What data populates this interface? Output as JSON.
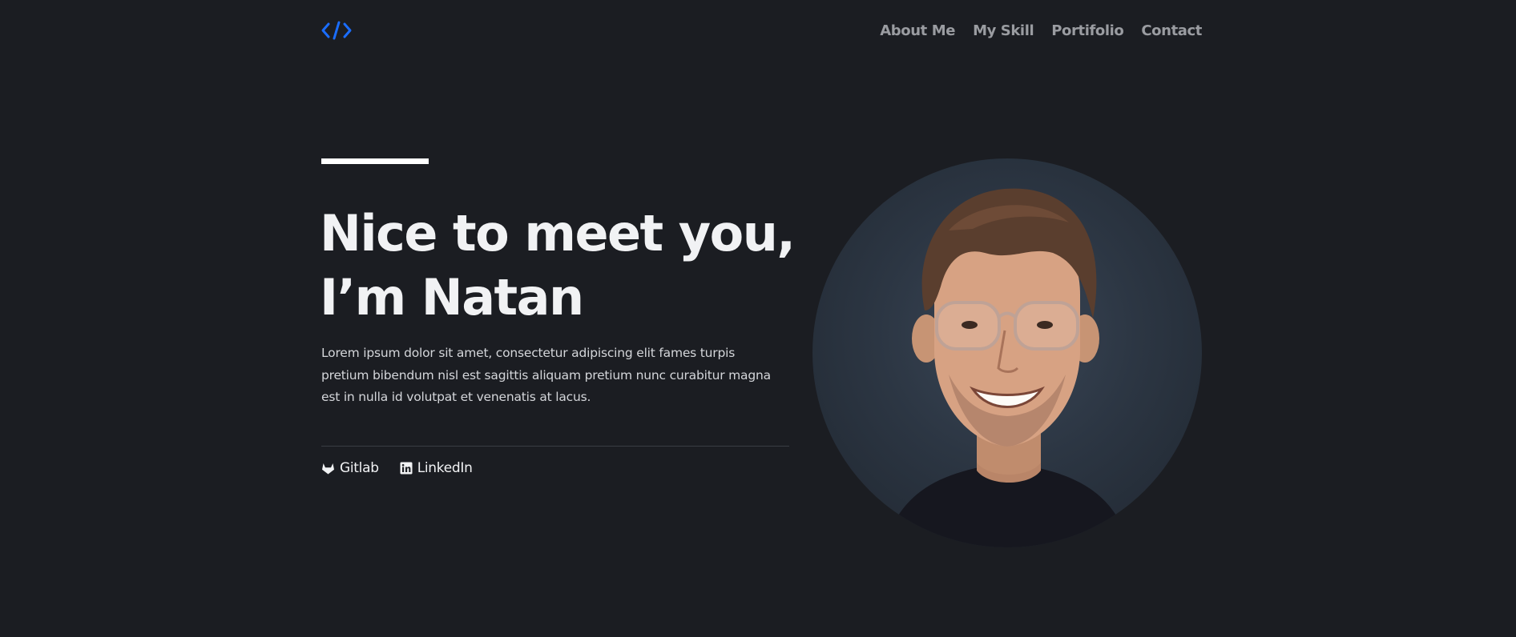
{
  "logo": {
    "icon": "code-brackets-icon",
    "color": "#1a6dff"
  },
  "nav": {
    "items": [
      {
        "label": "About Me"
      },
      {
        "label": "My Skill"
      },
      {
        "label": "Portifolio"
      },
      {
        "label": "Contact"
      }
    ]
  },
  "hero": {
    "headline_line1": "Nice to meet you,",
    "headline_line2": "I’m Natan",
    "intro": "Lorem ipsum dolor sit amet, consectetur adipiscing elit fames turpis pretium bibendum nisl est sagittis aliquam pretium nunc curabitur magna est in nulla id volutpat et venenatis at lacus.",
    "socials": [
      {
        "label": "Gitlab",
        "icon": "gitlab-icon"
      },
      {
        "label": "LinkedIn",
        "icon": "linkedin-icon"
      }
    ]
  },
  "profile_photo": {
    "icon": "avatar-photo"
  },
  "colors": {
    "background": "#1b1d22",
    "text": "#f1f2f4",
    "nav_text": "#9a9ca1",
    "accent": "#1a6dff"
  }
}
